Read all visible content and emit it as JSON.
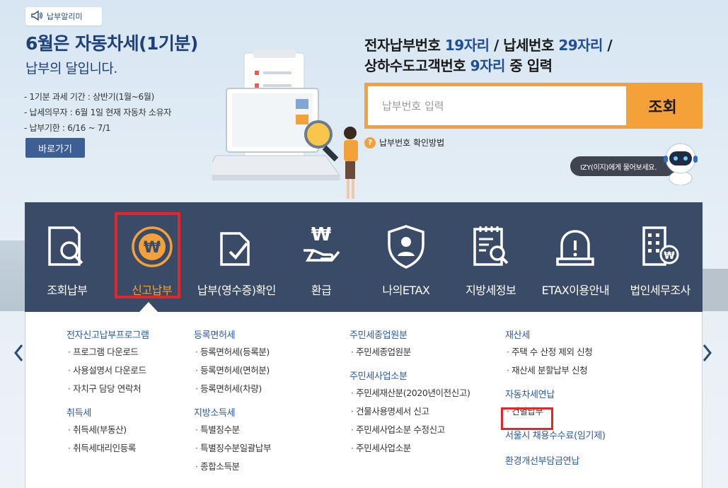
{
  "hero": {
    "badge": "납부알리미",
    "title": "6월은 자동차세(1기분)",
    "subtitle": "납부의 달입니다.",
    "details": [
      "- 1기분 과세 기간 : 상반기(1월~6월)",
      "- 납세의무자 : 6월 1일 현재 자동차 소유자",
      "- 납부기한 : 6/16 ~ 7/1"
    ],
    "go_button": "바로가기"
  },
  "search": {
    "title_line1_parts": [
      "전자납부번호 ",
      "19자리",
      " / 납세번호 ",
      "29자리",
      " /"
    ],
    "title_line2_parts": [
      "상하수도고객번호 ",
      "9자리",
      " 중 입력"
    ],
    "placeholder": "납부번호 입력",
    "button": "조회",
    "help_link": "납부번호 확인방법",
    "help_icon_glyph": "?",
    "izy_bubble": "IZY(이지)에게 물어보세요."
  },
  "menu": {
    "items": [
      {
        "label": "조회납부",
        "icon": "search-document-icon"
      },
      {
        "label": "신고납부",
        "icon": "won-coin-icon",
        "active": true
      },
      {
        "label": "납부(영수증)확인",
        "icon": "receipt-check-icon"
      },
      {
        "label": "환급",
        "icon": "hand-won-icon"
      },
      {
        "label": "나의ETAX",
        "icon": "shield-user-icon"
      },
      {
        "label": "지방세정보",
        "icon": "clipboard-search-icon"
      },
      {
        "label": "ETAX이용안내",
        "icon": "alert-siren-icon"
      },
      {
        "label": "법인세무조사",
        "icon": "building-won-icon"
      }
    ]
  },
  "panel": {
    "col1": {
      "groups": [
        {
          "title": "전자신고납부프로그램",
          "items": [
            "프로그램 다운로드",
            "사용설명서 다운로드",
            "자치구 담당 연락처"
          ]
        },
        {
          "title": "취득세",
          "items": [
            "취득세(부동산)",
            "취득세대리인등록"
          ]
        }
      ]
    },
    "col2": {
      "groups": [
        {
          "title": "등록면허세",
          "items": [
            "등록면허세(등록분)",
            "등록면허세(면허분)",
            "등록면허세(차량)"
          ]
        },
        {
          "title": "지방소득세",
          "items": [
            "특별징수분",
            "특별징수분일괄납부",
            "종합소득분"
          ]
        }
      ]
    },
    "col3": {
      "groups": [
        {
          "title": "주민세종업원분",
          "items": [
            "주민세종업원분"
          ]
        },
        {
          "title": "주민세사업소분",
          "items": [
            "주민세재산분(2020년이전신고)",
            "건물사용명세서 신고",
            "주민세사업소분 수정신고",
            "주민세사업소분"
          ]
        }
      ]
    },
    "col4": {
      "groups": [
        {
          "title": "재산세",
          "items": [
            "주택 수 산정 제외 신청",
            "재산세 분할납부 신청"
          ]
        },
        {
          "title": "자동차세연납",
          "items": [
            "건별납부"
          ]
        }
      ],
      "links": [
        "서울시 채용수수료(임기제)",
        "환경개선부담금연납"
      ]
    }
  },
  "colors": {
    "brand_navy": "#394b66",
    "accent_orange": "#f5a13a",
    "link_blue": "#2a58a8",
    "highlight_red": "#e4262a"
  }
}
